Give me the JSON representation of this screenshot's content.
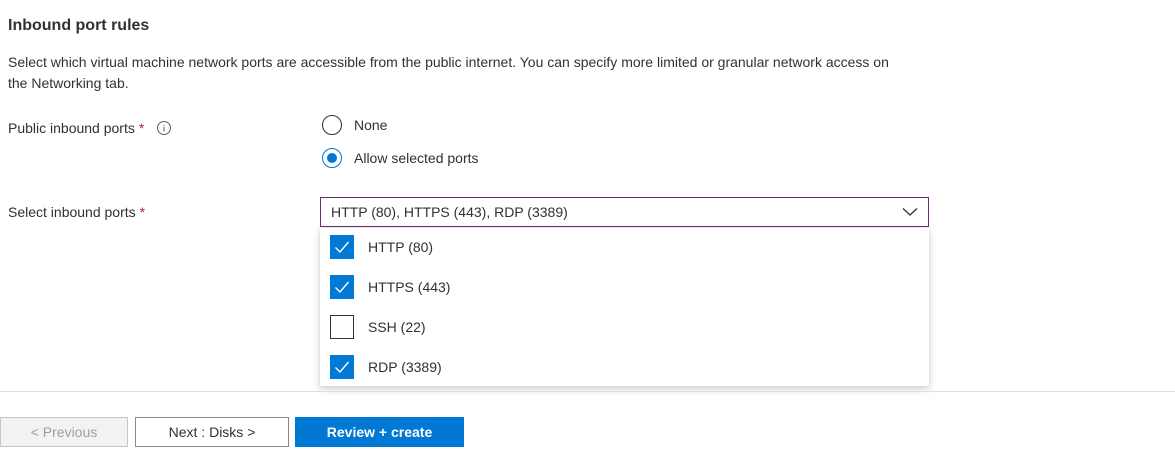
{
  "section": {
    "title": "Inbound port rules",
    "description": "Select which virtual machine network ports are accessible from the public internet. You can specify more limited or granular network access on the Networking tab."
  },
  "public_ports": {
    "label": "Public inbound ports",
    "required_mark": "*",
    "info_icon": "info-icon",
    "options": [
      {
        "label": "None",
        "selected": false
      },
      {
        "label": "Allow selected ports",
        "selected": true
      }
    ]
  },
  "select_ports": {
    "label": "Select inbound ports",
    "required_mark": "*",
    "value": "HTTP (80), HTTPS (443), RDP (3389)",
    "expanded": true,
    "options": [
      {
        "label": "HTTP (80)",
        "checked": true
      },
      {
        "label": "HTTPS (443)",
        "checked": true
      },
      {
        "label": "SSH (22)",
        "checked": false
      },
      {
        "label": "RDP (3389)",
        "checked": true
      }
    ]
  },
  "footer": {
    "previous_label": "< Previous",
    "next_label": "Next : Disks >",
    "review_label": "Review + create"
  },
  "colors": {
    "accent": "#0078d4",
    "required": "#a4262c",
    "dropdown_border": "#6e2a73"
  }
}
